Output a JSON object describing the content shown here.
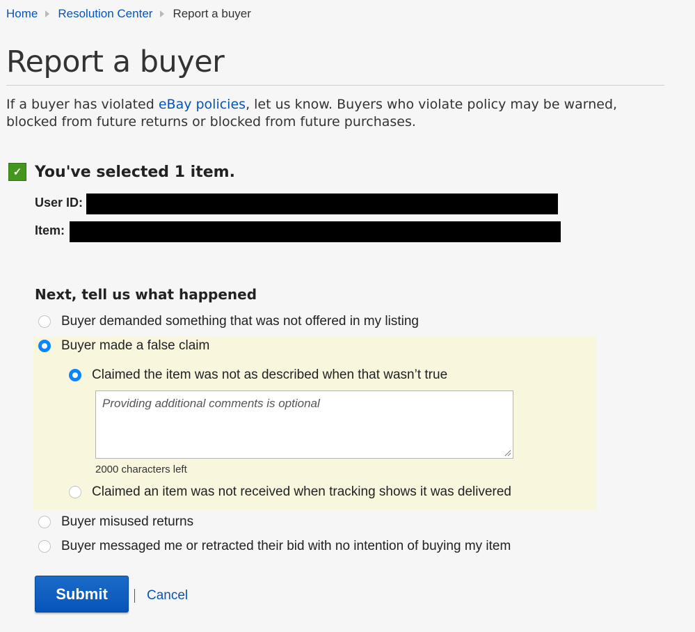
{
  "breadcrumb": {
    "items": [
      "Home",
      "Resolution Center"
    ],
    "current": "Report a buyer"
  },
  "page_title": "Report a buyer",
  "intro": {
    "before_link": "If a buyer has violated ",
    "link": "eBay policies",
    "after_link": ", let us know. Buyers who violate policy may be warned, blocked from future returns or blocked from future purchases."
  },
  "selection": {
    "message": "You've selected 1 item.",
    "user_id_label": "User ID:",
    "item_label": "Item:"
  },
  "question": {
    "heading": "Next, tell us what happened",
    "options": [
      "Buyer demanded something that was not offered in my listing",
      "Buyer made a false claim",
      "Buyer misused returns",
      "Buyer messaged me or retracted their bid with no intention of buying my item"
    ],
    "selected_option": "Buyer made a false claim",
    "sub_options": [
      "Claimed the item was not as described when that wasn’t true",
      "Claimed an item was not received when tracking shows it was delivered"
    ],
    "selected_sub_option": "Claimed the item was not as described when that wasn’t true",
    "comment_placeholder": "Providing additional comments is optional",
    "char_count": "2000 characters left"
  },
  "actions": {
    "submit": "Submit",
    "cancel": "Cancel"
  },
  "colors": {
    "link": "#0654ba",
    "check": "#45961d",
    "radio_selected": "#0a84ff",
    "highlight": "#f8f6dc",
    "submit": "#0654ba"
  }
}
